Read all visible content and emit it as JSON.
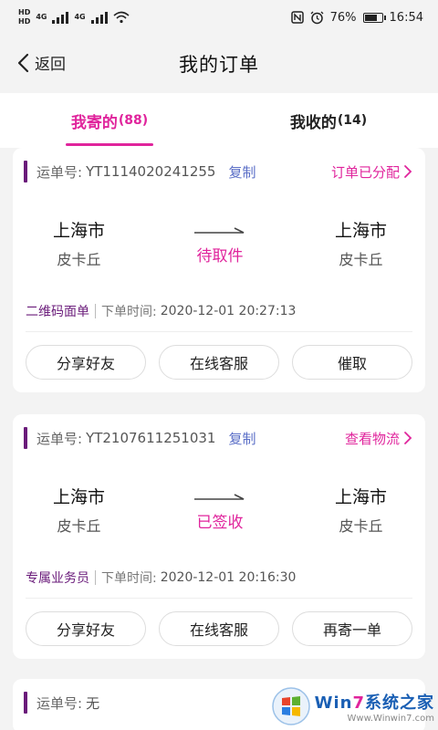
{
  "status_bar": {
    "hd1": "HD",
    "hd2": "HD",
    "net1": "4G",
    "net2": "4G",
    "battery": "76%",
    "battery_level": 0.76,
    "time": "16:54",
    "icons": [
      "nfc-icon",
      "alarm-icon",
      "wifi-icon"
    ]
  },
  "header": {
    "back_label": "返回",
    "title": "我的订单"
  },
  "tabs": [
    {
      "label": "我寄的",
      "count": "(88)",
      "active": true
    },
    {
      "label": "我收的",
      "count": "(14)",
      "active": false
    }
  ],
  "orders": [
    {
      "order_label": "运单号:",
      "order_no": "YT1114020241255",
      "copy_label": "复制",
      "status": "订单已分配",
      "from_city": "上海市",
      "from_district": "皮卡丘",
      "state": "待取件",
      "to_city": "上海市",
      "to_district": "皮卡丘",
      "tag": "二维码面单",
      "time_label": "下单时间:",
      "time": "2020-12-01 20:27:13",
      "buttons": [
        "分享好友",
        "在线客服",
        "催取"
      ]
    },
    {
      "order_label": "运单号:",
      "order_no": "YT2107611251031",
      "copy_label": "复制",
      "status": "查看物流",
      "from_city": "上海市",
      "from_district": "皮卡丘",
      "state": "已签收",
      "to_city": "上海市",
      "to_district": "皮卡丘",
      "tag": "专属业务员",
      "time_label": "下单时间:",
      "time": "2020-12-01 20:16:30",
      "buttons": [
        "分享好友",
        "在线客服",
        "再寄一单"
      ]
    },
    {
      "order_label": "运单号:",
      "order_no": "无"
    }
  ],
  "watermark": {
    "brand_a": "Win",
    "brand_b": "7",
    "brand_c": "系统之家",
    "site": "Www.Winwin7.com"
  },
  "colors": {
    "accent": "#e0249c",
    "tag": "#6a1b7a",
    "copy": "#5b6fc7"
  }
}
